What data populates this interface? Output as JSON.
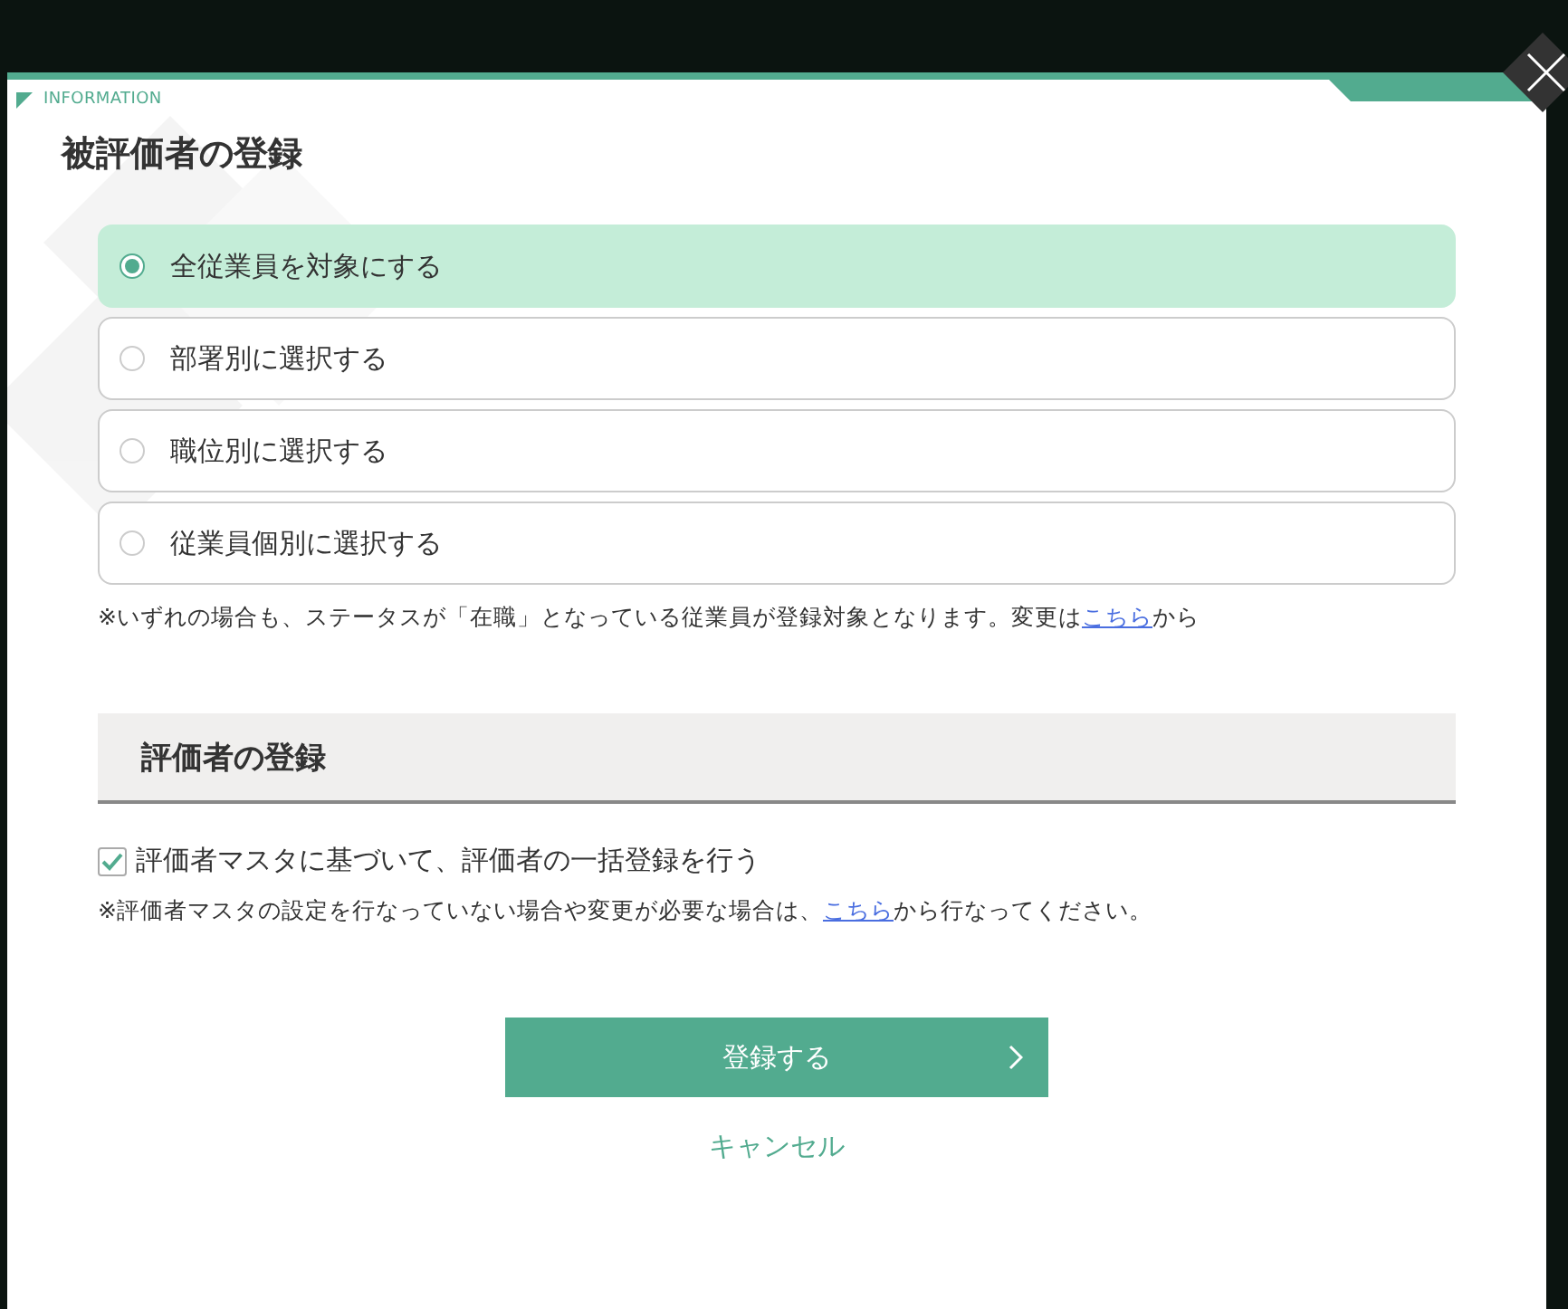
{
  "header": {
    "label": "INFORMATION"
  },
  "title": "被評価者の登録",
  "options": [
    {
      "label": "全従業員を対象にする",
      "selected": true
    },
    {
      "label": "部署別に選択する",
      "selected": false
    },
    {
      "label": "職位別に選択する",
      "selected": false
    },
    {
      "label": "従業員個別に選択する",
      "selected": false
    }
  ],
  "note": {
    "before": "※いずれの場合も、ステータスが「在職」となっている従業員が登録対象となります。変更は",
    "link": "こちら",
    "after": "から"
  },
  "section_title": "評価者の登録",
  "bulk_checkbox": {
    "label": "評価者マスタに基づいて、評価者の一括登録を行う",
    "checked": true
  },
  "note2": {
    "before": "※評価者マスタの設定を行なっていない場合や変更が必要な場合は、",
    "link": "こちら",
    "after": "から行なってください。"
  },
  "submit_button": "登録する",
  "cancel_link": "キャンセル"
}
